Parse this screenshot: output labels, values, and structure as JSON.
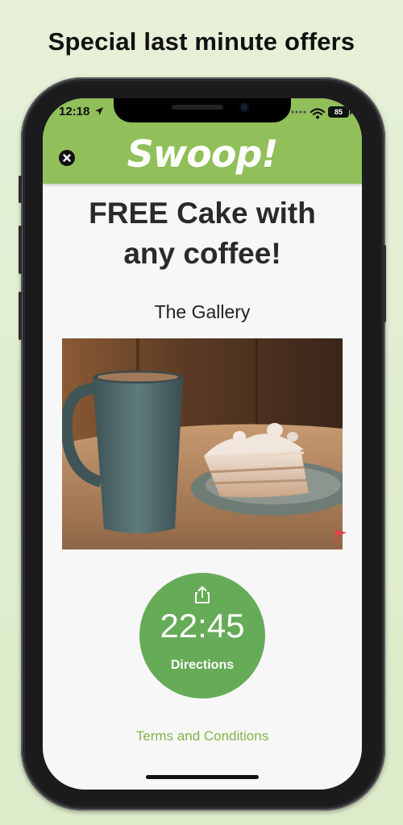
{
  "headline": "Special last minute offers",
  "status_bar": {
    "time": "12:18",
    "battery": "85",
    "icons": [
      "location-arrow-icon",
      "signal-icon",
      "wifi-icon",
      "battery-icon"
    ]
  },
  "app": {
    "logo": "Swoop!",
    "brand_color": "#91bf5a",
    "close_icon": "close-icon"
  },
  "offer": {
    "title_line1": "FREE Cake with",
    "title_line2": "any coffee!",
    "venue": "The Gallery",
    "image": "coffee-mug-and-cake-photo",
    "report_icon": "flag-icon"
  },
  "timer": {
    "countdown": "22:45",
    "directions_label": "Directions",
    "share_icon": "share-icon",
    "circle_color": "#66ab58"
  },
  "terms_label": "Terms and Conditions",
  "terms_color": "#80b54b"
}
